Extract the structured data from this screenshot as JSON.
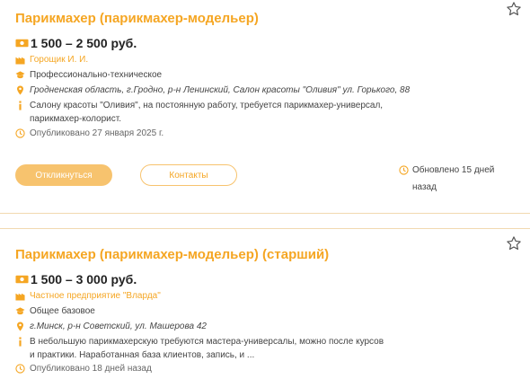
{
  "colors": {
    "accent": "#f5a623",
    "button_fill": "#f7c36e",
    "divider": "#f1d9b0"
  },
  "vacancies": [
    {
      "title": "Парикмахер (парикмахер-модельер)",
      "salary": "1 500 – 2 500 руб.",
      "employer": "Горощик И. И.",
      "education": "Профессионально-техническое",
      "location": "Гродненская область, г.Гродно, р-н Ленинский, Салон красоты \"Оливия\" ул. Горького, 88",
      "description_line1": "Салону красоты \"Оливия\", на постоянную работу, требуется парикмахер-универсал,",
      "description_line2": "парикмахер-колорист.",
      "published": "Опубликовано 27 января 2025 г.",
      "apply_label": "Откликнуться",
      "contacts_label": "Контакты",
      "updated": "Обновлено 15 дней назад"
    },
    {
      "title": "Парикмахер (парикмахер-модельер) (старший)",
      "salary": "1 500 – 3 000 руб.",
      "employer": "Частное предприятие \"Вларда\"",
      "education": "Общее базовое",
      "location": "г.Минск, р-н Советский, ул. Машерова 42",
      "description_line1": "В небольшую парикмахерскую требуются мастера-универсалы, можно после курсов",
      "description_line2": "и практики. Наработанная база клиентов, запись, и ...",
      "published": "Опубликовано 18 дней назад"
    }
  ],
  "icons": [
    "money-icon",
    "building-icon",
    "graduation-cap-icon",
    "location-pin-icon",
    "info-icon",
    "clock-icon",
    "star-icon"
  ]
}
